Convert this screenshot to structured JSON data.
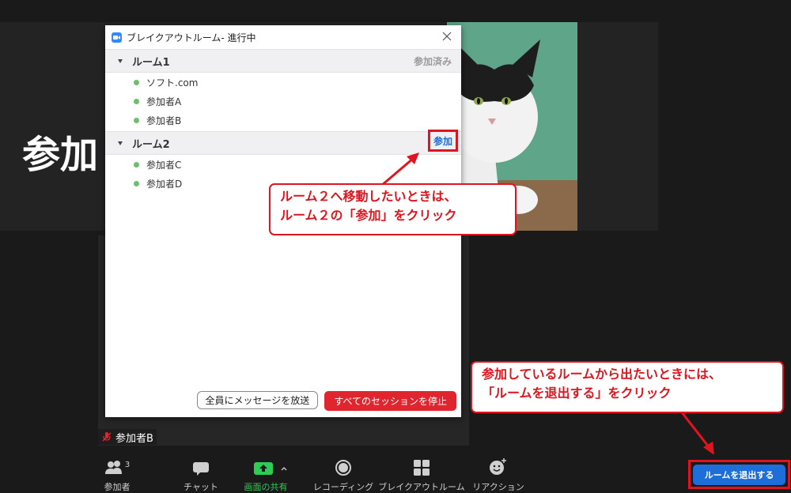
{
  "background": {
    "big_name": "参加",
    "name_tag": "参加者B"
  },
  "dialog": {
    "title": "ブレイクアウトルーム- 進行中",
    "rooms": [
      {
        "name": "ルーム1",
        "status": "参加済み",
        "participants": [
          "ソフト.com",
          "参加者A",
          "参加者B"
        ]
      },
      {
        "name": "ルーム2",
        "join_label": "参加",
        "participants": [
          "参加者C",
          "参加者D"
        ]
      }
    ],
    "broadcast_label": "全員にメッセージを放送",
    "stop_label": "すべてのセッションを停止"
  },
  "callouts": {
    "join_line1": "ルーム２へ移動したいときは、",
    "join_line2": "ルーム２の「参加」をクリック",
    "leave_line1": "参加しているルームから出たいときには、",
    "leave_line2": "「ルームを退出する」をクリック"
  },
  "toolbar": {
    "participants_label": "参加者",
    "participants_count": "3",
    "chat_label": "チャット",
    "share_label": "画面の共有",
    "record_label": "レコーディング",
    "breakout_label": "ブレイクアウトルーム",
    "reactions_label": "リアクション",
    "leave_label": "ルームを退出する"
  },
  "colors": {
    "accent_red": "#e0141e",
    "join_blue": "#1a6fd6",
    "share_green": "#2ecc55",
    "presence_green": "#6cc06a"
  }
}
